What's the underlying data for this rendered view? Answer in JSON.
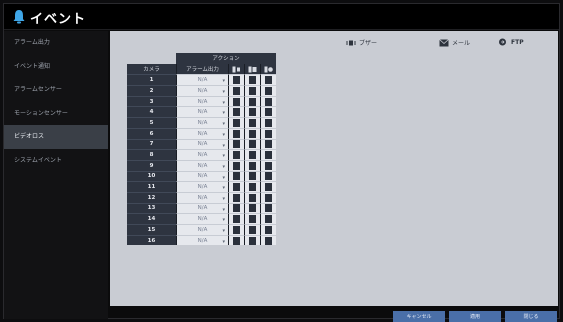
{
  "header": {
    "title": "イベント"
  },
  "sidebar": {
    "items": [
      {
        "label": "アラーム出力"
      },
      {
        "label": "イベント通知"
      },
      {
        "label": "アラームセンサー"
      },
      {
        "label": "モーションセンサー"
      },
      {
        "label": "ビデオロス"
      },
      {
        "label": "システムイベント"
      }
    ],
    "active_index": 4
  },
  "legend": {
    "buzzer": "ブザー",
    "email": "メール",
    "ftp": "FTP"
  },
  "table": {
    "group_header": "アクション",
    "camera_header": "カメラ",
    "alarm_header": "アラーム出力",
    "rows": [
      {
        "camera": "1",
        "alarm_output": "N/A"
      },
      {
        "camera": "2",
        "alarm_output": "N/A"
      },
      {
        "camera": "3",
        "alarm_output": "N/A"
      },
      {
        "camera": "4",
        "alarm_output": "N/A"
      },
      {
        "camera": "5",
        "alarm_output": "N/A"
      },
      {
        "camera": "6",
        "alarm_output": "N/A"
      },
      {
        "camera": "7",
        "alarm_output": "N/A"
      },
      {
        "camera": "8",
        "alarm_output": "N/A"
      },
      {
        "camera": "9",
        "alarm_output": "N/A"
      },
      {
        "camera": "10",
        "alarm_output": "N/A"
      },
      {
        "camera": "11",
        "alarm_output": "N/A"
      },
      {
        "camera": "12",
        "alarm_output": "N/A"
      },
      {
        "camera": "13",
        "alarm_output": "N/A"
      },
      {
        "camera": "14",
        "alarm_output": "N/A"
      },
      {
        "camera": "15",
        "alarm_output": "N/A"
      },
      {
        "camera": "16",
        "alarm_output": "N/A"
      }
    ]
  },
  "footer": {
    "cancel": "キャンセル",
    "apply": "適用",
    "close": "閉じる"
  },
  "colors": {
    "accent": "#4a6fa8",
    "header_dark": "#2e3440",
    "content_bg": "#c9ccd3"
  }
}
